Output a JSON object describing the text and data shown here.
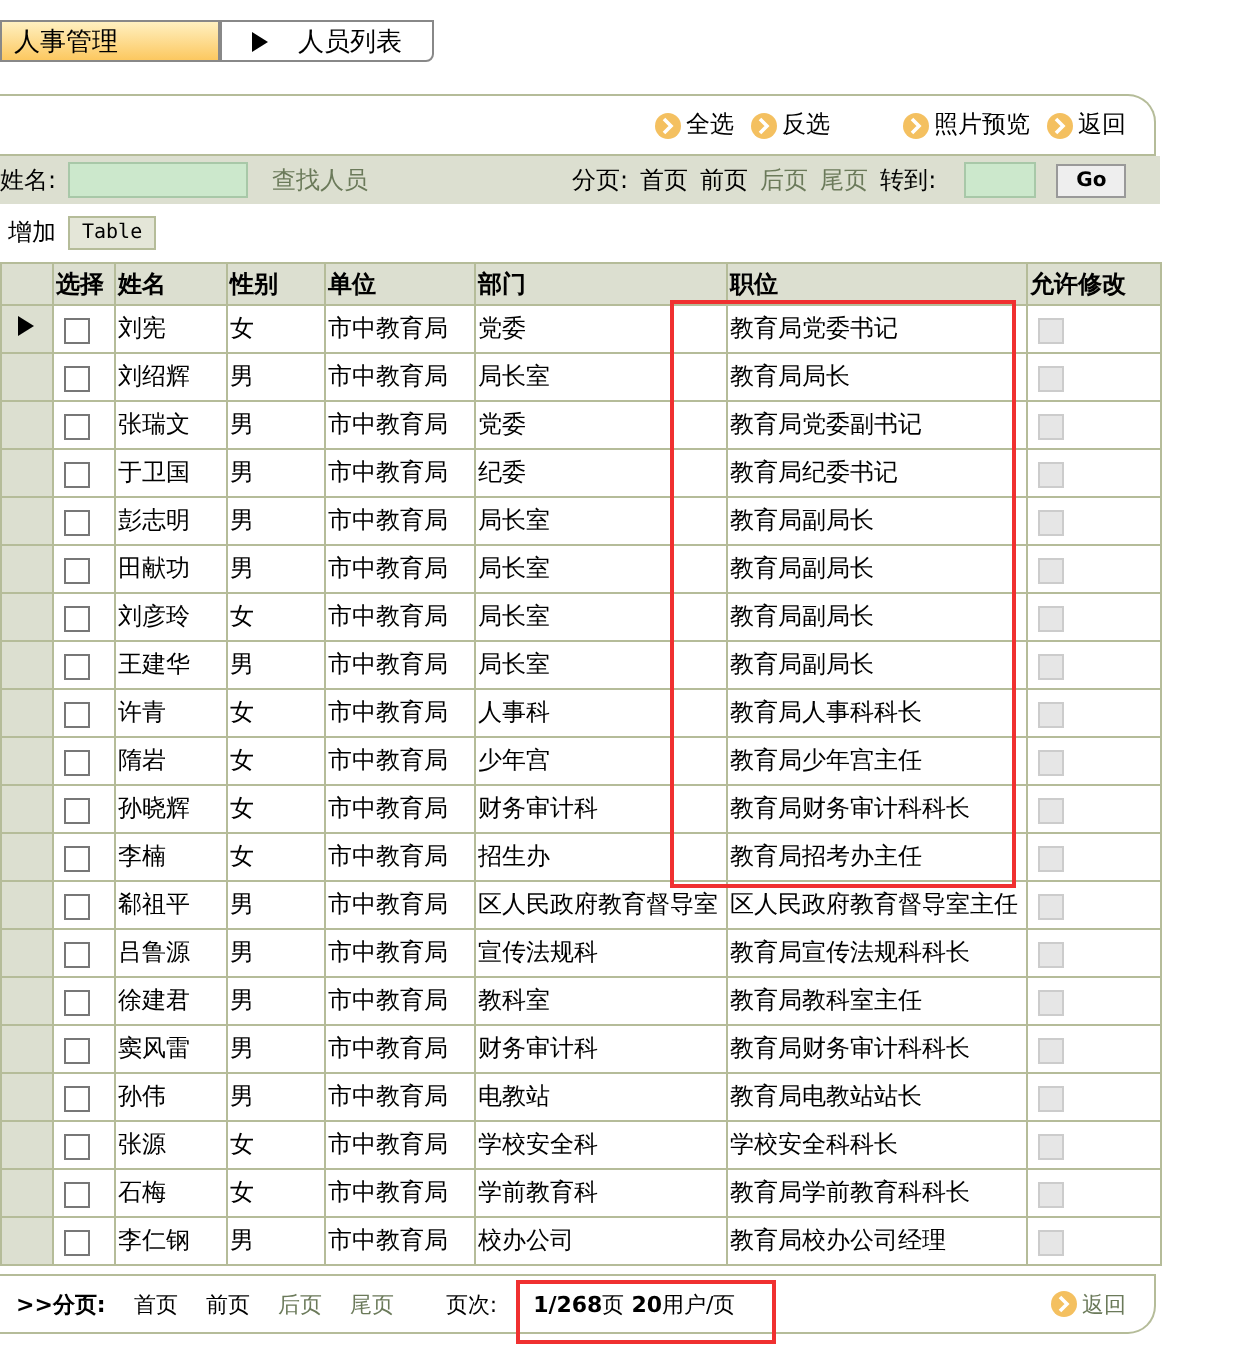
{
  "tabs": [
    {
      "label": "人事管理",
      "selected": true,
      "icon": false
    },
    {
      "label": "人员列表",
      "selected": false,
      "icon": true
    }
  ],
  "actions": [
    {
      "label": "全选"
    },
    {
      "label": "反选"
    },
    {
      "label": "照片预览"
    },
    {
      "label": "返回"
    }
  ],
  "search": {
    "label": "姓名:",
    "link": "查找人员"
  },
  "pager": {
    "label": "分页:",
    "links": [
      {
        "label": "首页",
        "disabled": false
      },
      {
        "label": "前页",
        "disabled": false
      },
      {
        "label": "后页",
        "disabled": true
      },
      {
        "label": "尾页",
        "disabled": true
      }
    ],
    "goto_label": "转到:",
    "go": "Go"
  },
  "add": {
    "label": "增加",
    "button": "Table"
  },
  "table": {
    "select_column": "选择",
    "columns": [
      "姓名",
      "性别",
      "单位",
      "部门",
      "职位"
    ],
    "edit_column": "允许修改",
    "rows": [
      {
        "selected": true,
        "checked": false,
        "editable": false,
        "cells": [
          "刘宪",
          "女",
          "市中教育局",
          "党委",
          "教育局党委书记"
        ]
      },
      {
        "selected": false,
        "checked": false,
        "editable": false,
        "cells": [
          "刘绍辉",
          "男",
          "市中教育局",
          "局长室",
          "教育局局长"
        ]
      },
      {
        "selected": false,
        "checked": false,
        "editable": false,
        "cells": [
          "张瑞文",
          "男",
          "市中教育局",
          "党委",
          "教育局党委副书记"
        ]
      },
      {
        "selected": false,
        "checked": false,
        "editable": false,
        "cells": [
          "于卫国",
          "男",
          "市中教育局",
          "纪委",
          "教育局纪委书记"
        ]
      },
      {
        "selected": false,
        "checked": false,
        "editable": false,
        "cells": [
          "彭志明",
          "男",
          "市中教育局",
          "局长室",
          "教育局副局长"
        ]
      },
      {
        "selected": false,
        "checked": false,
        "editable": false,
        "cells": [
          "田献功",
          "男",
          "市中教育局",
          "局长室",
          "教育局副局长"
        ]
      },
      {
        "selected": false,
        "checked": false,
        "editable": false,
        "cells": [
          "刘彦玲",
          "女",
          "市中教育局",
          "局长室",
          "教育局副局长"
        ]
      },
      {
        "selected": false,
        "checked": false,
        "editable": false,
        "cells": [
          "王建华",
          "男",
          "市中教育局",
          "局长室",
          "教育局副局长"
        ]
      },
      {
        "selected": false,
        "checked": false,
        "editable": false,
        "cells": [
          "许青",
          "女",
          "市中教育局",
          "人事科",
          "教育局人事科科长"
        ]
      },
      {
        "selected": false,
        "checked": false,
        "editable": false,
        "cells": [
          "隋岩",
          "女",
          "市中教育局",
          "少年宫",
          "教育局少年宫主任"
        ]
      },
      {
        "selected": false,
        "checked": false,
        "editable": false,
        "cells": [
          "孙晓辉",
          "女",
          "市中教育局",
          "财务审计科",
          "教育局财务审计科科长"
        ]
      },
      {
        "selected": false,
        "checked": false,
        "editable": false,
        "cells": [
          "李楠",
          "女",
          "市中教育局",
          "招生办",
          "教育局招考办主任"
        ]
      },
      {
        "selected": false,
        "checked": false,
        "editable": false,
        "cells": [
          "郗祖平",
          "男",
          "市中教育局",
          "区人民政府教育督导室",
          "区人民政府教育督导室主任"
        ]
      },
      {
        "selected": false,
        "checked": false,
        "editable": false,
        "cells": [
          "吕鲁源",
          "男",
          "市中教育局",
          "宣传法规科",
          "教育局宣传法规科科长"
        ]
      },
      {
        "selected": false,
        "checked": false,
        "editable": false,
        "cells": [
          "徐建君",
          "男",
          "市中教育局",
          "教科室",
          "教育局教科室主任"
        ]
      },
      {
        "selected": false,
        "checked": false,
        "editable": false,
        "cells": [
          "窦风雷",
          "男",
          "市中教育局",
          "财务审计科",
          "教育局财务审计科科长"
        ]
      },
      {
        "selected": false,
        "checked": false,
        "editable": false,
        "cells": [
          "孙伟",
          "男",
          "市中教育局",
          "电教站",
          "教育局电教站站长"
        ]
      },
      {
        "selected": false,
        "checked": false,
        "editable": false,
        "cells": [
          "张源",
          "女",
          "市中教育局",
          "学校安全科",
          "学校安全科科长"
        ]
      },
      {
        "selected": false,
        "checked": false,
        "editable": false,
        "cells": [
          "石梅",
          "女",
          "市中教育局",
          "学前教育科",
          "教育局学前教育科科长"
        ]
      },
      {
        "selected": false,
        "checked": false,
        "editable": false,
        "cells": [
          "李仁钢",
          "男",
          "市中教育局",
          "校办公司",
          "教育局校办公司经理"
        ]
      }
    ]
  },
  "footer": {
    "label": ">>分页:",
    "links": [
      {
        "label": "首页",
        "disabled": false
      },
      {
        "label": "前页",
        "disabled": false
      },
      {
        "label": "后页",
        "disabled": true
      },
      {
        "label": "尾页",
        "disabled": true
      }
    ],
    "page_label": "页次:",
    "page_info": "**1/268**页 **20**用户/页",
    "back": "返回"
  }
}
